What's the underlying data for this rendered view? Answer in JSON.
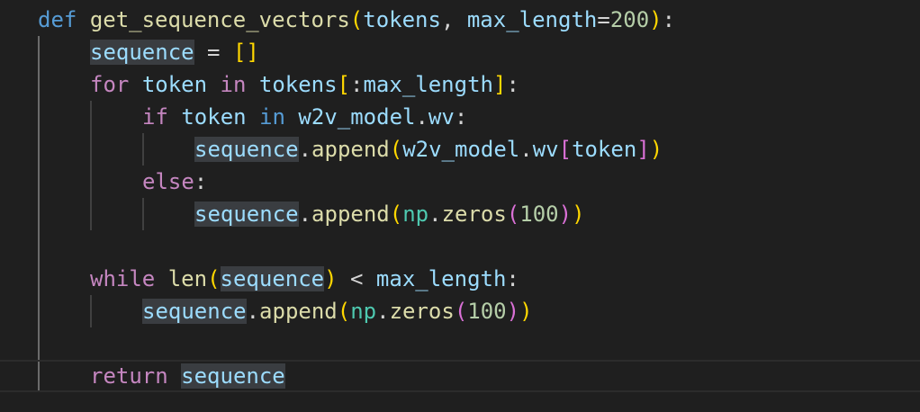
{
  "editor": {
    "language": "python",
    "lines": [
      {
        "tokens": [
          {
            "t": "def",
            "c": "kw-blue"
          },
          {
            "t": " "
          },
          {
            "t": "get_sequence_vectors",
            "c": "fn"
          },
          {
            "t": "(",
            "c": "b1"
          },
          {
            "t": "tokens",
            "c": "var"
          },
          {
            "t": ", ",
            "c": "op"
          },
          {
            "t": "max_length",
            "c": "var"
          },
          {
            "t": "=",
            "c": "op"
          },
          {
            "t": "200",
            "c": "num"
          },
          {
            "t": ")",
            "c": "b1"
          },
          {
            "t": ":",
            "c": "op"
          }
        ]
      },
      {
        "tokens": [
          {
            "t": "sequence",
            "c": "var hl"
          },
          {
            "t": " = ",
            "c": "op"
          },
          {
            "t": "[",
            "c": "b1"
          },
          {
            "t": "]",
            "c": "b1"
          }
        ]
      },
      {
        "tokens": [
          {
            "t": "for",
            "c": "kw-purple"
          },
          {
            "t": " "
          },
          {
            "t": "token",
            "c": "var"
          },
          {
            "t": " "
          },
          {
            "t": "in",
            "c": "kw-purple"
          },
          {
            "t": " "
          },
          {
            "t": "tokens",
            "c": "var"
          },
          {
            "t": "[",
            "c": "b1"
          },
          {
            "t": ":",
            "c": "op"
          },
          {
            "t": "max_length",
            "c": "var"
          },
          {
            "t": "]",
            "c": "b1"
          },
          {
            "t": ":",
            "c": "op"
          }
        ]
      },
      {
        "tokens": [
          {
            "t": "if",
            "c": "kw-purple"
          },
          {
            "t": " "
          },
          {
            "t": "token",
            "c": "var"
          },
          {
            "t": " "
          },
          {
            "t": "in",
            "c": "kw-blue"
          },
          {
            "t": " "
          },
          {
            "t": "w2v_model",
            "c": "var"
          },
          {
            "t": ".",
            "c": "op"
          },
          {
            "t": "wv",
            "c": "var"
          },
          {
            "t": ":",
            "c": "op"
          }
        ]
      },
      {
        "tokens": [
          {
            "t": "sequence",
            "c": "var hl"
          },
          {
            "t": ".",
            "c": "op"
          },
          {
            "t": "append",
            "c": "fn"
          },
          {
            "t": "(",
            "c": "b1"
          },
          {
            "t": "w2v_model",
            "c": "var"
          },
          {
            "t": ".",
            "c": "op"
          },
          {
            "t": "wv",
            "c": "var"
          },
          {
            "t": "[",
            "c": "b2"
          },
          {
            "t": "token",
            "c": "var"
          },
          {
            "t": "]",
            "c": "b2"
          },
          {
            "t": ")",
            "c": "b1"
          }
        ]
      },
      {
        "tokens": [
          {
            "t": "else",
            "c": "kw-purple"
          },
          {
            "t": ":",
            "c": "op"
          }
        ]
      },
      {
        "tokens": [
          {
            "t": "sequence",
            "c": "var hl"
          },
          {
            "t": ".",
            "c": "op"
          },
          {
            "t": "append",
            "c": "fn"
          },
          {
            "t": "(",
            "c": "b1"
          },
          {
            "t": "np",
            "c": "cls"
          },
          {
            "t": ".",
            "c": "op"
          },
          {
            "t": "zeros",
            "c": "fn"
          },
          {
            "t": "(",
            "c": "b2"
          },
          {
            "t": "100",
            "c": "num"
          },
          {
            "t": ")",
            "c": "b2"
          },
          {
            "t": ")",
            "c": "b1"
          }
        ]
      },
      {
        "tokens": []
      },
      {
        "tokens": [
          {
            "t": "while",
            "c": "kw-purple"
          },
          {
            "t": " "
          },
          {
            "t": "len",
            "c": "fn"
          },
          {
            "t": "(",
            "c": "b1"
          },
          {
            "t": "sequence",
            "c": "var hl"
          },
          {
            "t": ")",
            "c": "b1"
          },
          {
            "t": " < ",
            "c": "op"
          },
          {
            "t": "max_length",
            "c": "var"
          },
          {
            "t": ":",
            "c": "op"
          }
        ]
      },
      {
        "tokens": [
          {
            "t": "sequence",
            "c": "var hl"
          },
          {
            "t": ".",
            "c": "op"
          },
          {
            "t": "append",
            "c": "fn"
          },
          {
            "t": "(",
            "c": "b1"
          },
          {
            "t": "np",
            "c": "cls"
          },
          {
            "t": ".",
            "c": "op"
          },
          {
            "t": "zeros",
            "c": "fn"
          },
          {
            "t": "(",
            "c": "b2"
          },
          {
            "t": "100",
            "c": "num"
          },
          {
            "t": ")",
            "c": "b2"
          },
          {
            "t": ")",
            "c": "b1"
          }
        ]
      },
      {
        "tokens": []
      },
      {
        "tokens": [
          {
            "t": "return",
            "c": "kw-purple"
          },
          {
            "t": " "
          },
          {
            "t": "sequence",
            "c": "var hl"
          }
        ]
      }
    ]
  }
}
